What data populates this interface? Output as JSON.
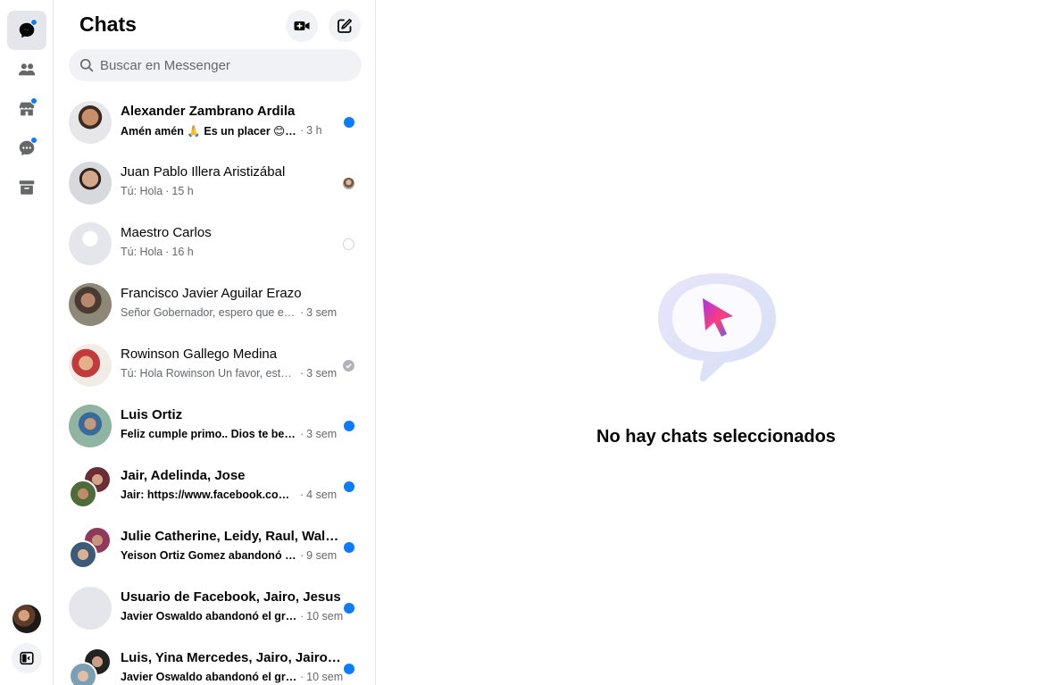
{
  "header": {
    "title": "Chats"
  },
  "search": {
    "placeholder": "Buscar en Messenger"
  },
  "rail": {
    "items": [
      {
        "icon": "chat-bubble-icon",
        "active": true,
        "badge": true
      },
      {
        "icon": "people-icon",
        "active": false,
        "badge": false
      },
      {
        "icon": "marketplace-icon",
        "active": false,
        "badge": true
      },
      {
        "icon": "message-requests-icon",
        "active": false,
        "badge": true
      },
      {
        "icon": "archive-icon",
        "active": false,
        "badge": false
      }
    ]
  },
  "chats": [
    {
      "name": "Alexander Zambrano Ardila",
      "snippet": "Amén amén 🙏 Es un placer 😊 Que el Señor te bendiga",
      "time": "3 h",
      "unread": true,
      "status": "unread"
    },
    {
      "name": "Juan Pablo Illera Aristizábal",
      "snippet": "Tú: Hola",
      "time": "15 h",
      "unread": false,
      "status": "seen"
    },
    {
      "name": "Maestro Carlos",
      "snippet": "Tú: Hola",
      "time": "16 h",
      "unread": false,
      "status": "sent"
    },
    {
      "name": "Francisco Javier Aguilar Erazo",
      "snippet": "Señor Gobernador, espero que esté muy bien",
      "time": "3 sem",
      "unread": false,
      "status": "none"
    },
    {
      "name": "Rowinson Gallego Medina",
      "snippet": "Tú: Hola Rowinson Un favor, estoy buscando",
      "time": "3 sem",
      "unread": false,
      "status": "delivered"
    },
    {
      "name": "Luis Ortiz",
      "snippet": "Feliz cumple primo.. Dios te bendiga",
      "time": "3 sem",
      "unread": true,
      "status": "unread"
    },
    {
      "name": "Jair, Adelinda, Jose",
      "snippet": "Jair: https://www.facebook.com/share",
      "time": "4 sem",
      "unread": true,
      "status": "unread"
    },
    {
      "name": "Julie Catherine, Leidy, Raul, Walter",
      "snippet": "Yeison Ortiz Gomez abandonó el grupo",
      "time": "9 sem",
      "unread": true,
      "status": "unread"
    },
    {
      "name": "Usuario de Facebook, Jairo, Jesus",
      "snippet": "Javier Oswaldo abandonó el grupo",
      "time": "10 sem",
      "unread": true,
      "status": "unread"
    },
    {
      "name": "Luis, Yina Mercedes, Jairo, Jairo, Yeison",
      "snippet": "Javier Oswaldo abandonó el grupo",
      "time": "10 sem",
      "unread": true,
      "status": "unread"
    }
  ],
  "main": {
    "empty_text": "No hay chats seleccionados"
  },
  "colors": {
    "accent": "#0a7cff",
    "muted": "#65676b",
    "panel_bg": "#f0f2f5"
  }
}
